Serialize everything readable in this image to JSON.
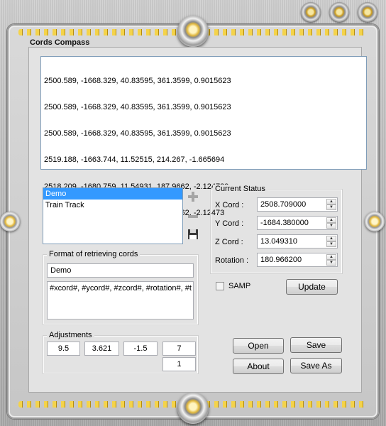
{
  "window": {
    "title": "Cords Compass"
  },
  "output": {
    "lines": [
      "2500.589, -1668.329, 40.83595, 361.3599, 0.9015623",
      "2500.589, -1668.329, 40.83595, 361.3599, 0.9015623",
      "2500.589, -1668.329, 40.83595, 361.3599, 0.9015623",
      "2519.188, -1663.744, 11.52515, 214.267, -1.665694",
      "2518.209, -1680.759, 11.54931, 187.9662, -2.124729",
      "2518.209, -1680.759, 11.54931, 187.9662, -2.12473"
    ]
  },
  "profiles": {
    "items": [
      {
        "label": "Demo",
        "selected": true
      },
      {
        "label": "Train Track",
        "selected": false
      }
    ]
  },
  "tools": {
    "add_icon": "plus-icon",
    "remove_icon": "minus-icon",
    "save_icon": "floppy-icon"
  },
  "format": {
    "legend": "Format of retrieving cords",
    "name_value": "Demo",
    "template_value": "#xcord#, #ycord#, #zcord#, #rotation#, #t"
  },
  "adjustments": {
    "legend": "Adjustments",
    "values": [
      "9.5",
      "3.621",
      "-1.5",
      "7",
      "1"
    ]
  },
  "status": {
    "legend": "Current Status",
    "x_label": "X Cord :",
    "x_value": "2508.709000",
    "y_label": "Y Cord :",
    "y_value": "-1684.380000",
    "z_label": "Z Cord :",
    "z_value": "13.049310",
    "r_label": "Rotation :",
    "r_value": "180.966200"
  },
  "samp": {
    "label": "SAMP",
    "checked": false
  },
  "buttons": {
    "update": "Update",
    "open": "Open",
    "save": "Save",
    "about": "About",
    "save_as": "Save As"
  }
}
